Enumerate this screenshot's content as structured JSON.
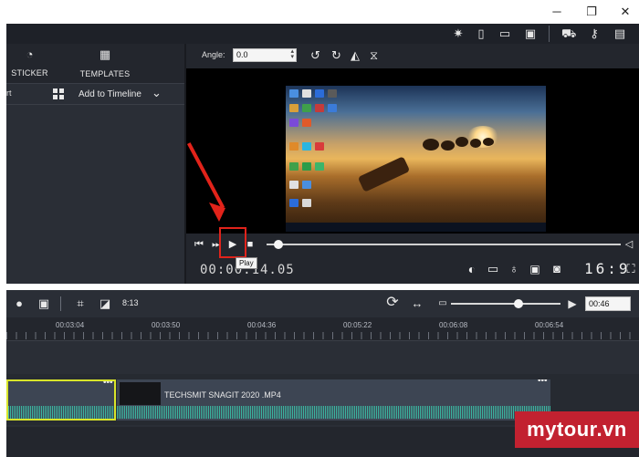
{
  "window": {
    "minimize": "─",
    "maximize": "❐",
    "close": "✕"
  },
  "toolbar_icons": [
    {
      "name": "effects-icon",
      "glyph": "✷"
    },
    {
      "name": "new-file-icon",
      "glyph": "▯"
    },
    {
      "name": "open-folder-icon",
      "glyph": "▭"
    },
    {
      "name": "save-icon",
      "glyph": "▣"
    },
    {
      "name": "cart-icon",
      "glyph": "⛟"
    },
    {
      "name": "key-icon",
      "glyph": "⚷"
    },
    {
      "name": "bag-icon",
      "glyph": "▤"
    }
  ],
  "left_panel": {
    "tabs": [
      {
        "label": "STICKER",
        "icon": "◔"
      },
      {
        "label": "TEMPLATES",
        "icon": "▦"
      }
    ],
    "subbar": {
      "left_text": "rt",
      "add_label": "Add to Timeline",
      "chevron": "⌄"
    }
  },
  "preview": {
    "angle_label": "Angle:",
    "angle_value": "0.0",
    "transform_icons": [
      "↺",
      "↻",
      "◭",
      "⧖"
    ]
  },
  "playback": {
    "timecode": "00:00:14.05",
    "tooltip": "Play",
    "ratio": "16:9"
  },
  "timeline": {
    "ratio_label": "8:13",
    "zoom_value": "00:46",
    "ruler_labels": [
      "00:03:04",
      "00:03:50",
      "00:04:36",
      "00:05:22",
      "00:06:08",
      "00:06:54"
    ],
    "clip_title": "TECHSMIT SNAGIT 2020 .MP4",
    "clip_menu": "•••"
  },
  "watermark": "mytour.vn",
  "colors": {
    "highlight": "#e0231b",
    "wave": "#3bb5a0",
    "selected_clip": "#d9e52a",
    "watermark": "#c22130"
  }
}
